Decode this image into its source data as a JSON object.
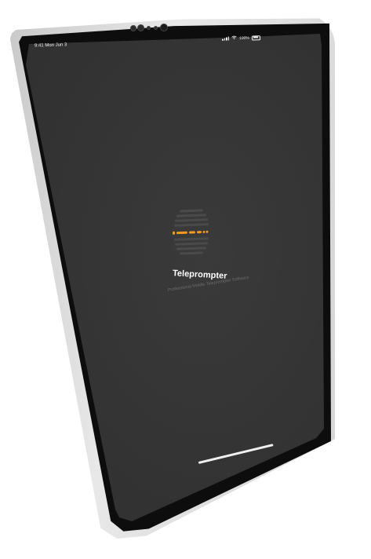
{
  "status_bar": {
    "time_date": "9:41 Mon Jun 3",
    "battery_percent": "100%",
    "wifi_icon": "wifi-icon",
    "signal_icon": "signal-icon",
    "battery_icon": "battery-icon"
  },
  "splash": {
    "logo_icon": "teleprompter-logo-icon",
    "app_name": "Teleprompter",
    "tagline": "Professional Mobile Teleprompter Software"
  },
  "colors": {
    "screen_bg": "#333333",
    "accent_orange": "#f29a1f",
    "title_text": "#ffffff",
    "tagline_text": "#6b6b6b",
    "frame_silver": "#d9d9d9",
    "bezel_black": "#0d0d0d"
  }
}
